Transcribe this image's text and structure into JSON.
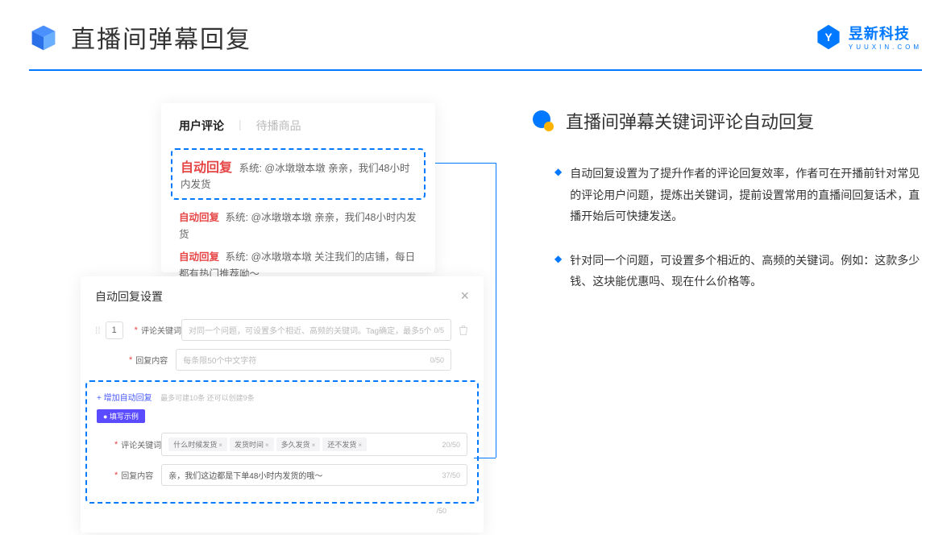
{
  "header": {
    "title": "直播间弹幕回复"
  },
  "brand": {
    "name": "昱新科技",
    "sub": "YUUXIN.COM"
  },
  "comments": {
    "tab_active": "用户评论",
    "tab_inactive": "待播商品",
    "highlighted": {
      "tag": "自动回复",
      "text": "系统: @冰墩墩本墩 亲亲，我们48小时内发货"
    },
    "line2": {
      "tag": "自动回复",
      "text": "系统: @冰墩墩本墩 亲亲，我们48小时内发货"
    },
    "line3": {
      "tag": "自动回复",
      "text": "系统: @冰墩墩本墩 关注我们的店铺，每日都有热门推荐呦～"
    }
  },
  "settings": {
    "title": "自动回复设置",
    "num": "1",
    "keyword_label": "评论关键词",
    "keyword_ph": "对同一个问题，可设置多个相近、高频的关键词。Tag确定，最多5个",
    "keyword_counter": "0/5",
    "content_label": "回复内容",
    "content_ph": "每条限50个中文字符",
    "content_counter": "0/50",
    "add_link": "+ 增加自动回复",
    "add_sub": "最多可建10条 还可以创建9条",
    "ex_badge": "● 填写示例",
    "ex_kw_label": "评论关键词",
    "ex_tags": [
      "什么时候发货",
      "发货时间",
      "多久发货",
      "还不发货"
    ],
    "ex_kw_counter": "20/50",
    "ex_ct_label": "回复内容",
    "ex_ct_val": "亲，我们这边都是下单48小时内发货的哦～",
    "ex_ct_counter": "37/50",
    "outer_counter": "/50"
  },
  "right": {
    "section_title": "直播间弹幕关键词评论自动回复",
    "b1": "自动回复设置为了提升作者的评论回复效率，作者可在开播前针对常见的评论用户问题，提炼出关键词，提前设置常用的直播间回复话术，直播开始后可快捷发送。",
    "b2": "针对同一个问题，可设置多个相近的、高频的关键词。例如：这款多少钱、这块能优惠吗、现在什么价格等。"
  }
}
